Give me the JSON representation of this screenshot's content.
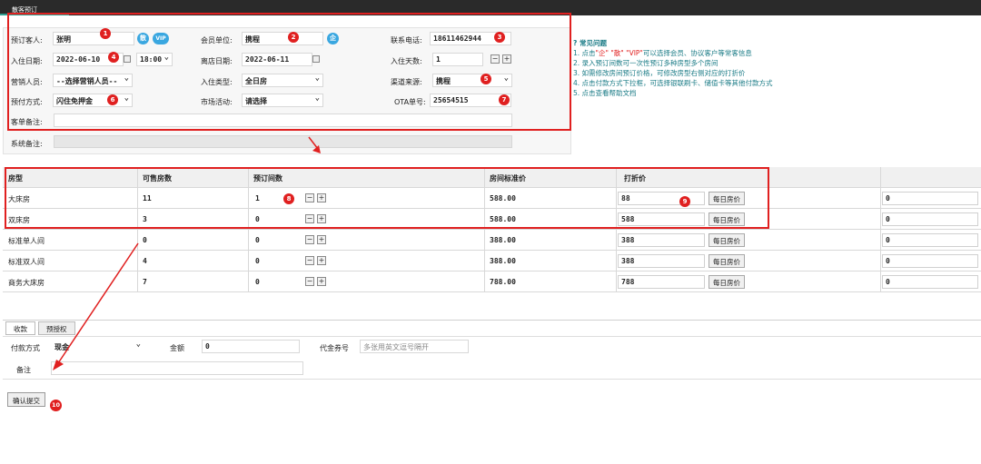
{
  "window": {
    "tab_title": "散客预订"
  },
  "form": {
    "guest_label": "预订客人:",
    "guest_value": "张明",
    "discount_icon": "散",
    "vip_icon": "VIP",
    "member_label": "会员单位:",
    "member_value": "携程",
    "member_icon": "企",
    "phone_label": "联系电话:",
    "phone_value": "18611462944",
    "checkin_label": "入住日期:",
    "checkin_value": "2022-06-10",
    "checkin_time": "18:00",
    "checkout_label": "离店日期:",
    "checkout_value": "2022-06-11",
    "days_label": "入住天数:",
    "days_value": "1",
    "sales_label": "营销人员:",
    "sales_value": "--选择营销人员--",
    "type_label": "入住类型:",
    "type_value": "全日房",
    "channel_label": "渠道来源:",
    "channel_value": "携程",
    "pay_label": "预付方式:",
    "pay_value": "闪住免押金",
    "market_label": "市场活动:",
    "market_value": "请选择",
    "ota_label": "OTA单号:",
    "ota_value": "25654515",
    "remark_label": "客单备注:",
    "remark_value": "",
    "sys_remark_label": "系统备注:"
  },
  "faq": {
    "title": "? 常见问题",
    "items": [
      [
        "1. 点击",
        "\"企\" \"散\" \"VIP\"",
        "可以选择会员、协议客户等常客信息"
      ],
      [
        "2. 录入预订间数可一次性预订多种房型多个房间",
        "",
        ""
      ],
      [
        "3. 如需修改房间预订价格，可修改房型右侧对应的打折价",
        "",
        ""
      ],
      [
        "4. 点击付款方式下拉框，可选择银联刷卡、储值卡等其他付款方式",
        "",
        ""
      ],
      [
        "5. 点击查看帮助文档",
        "",
        ""
      ]
    ]
  },
  "table": {
    "headers": [
      "房型",
      "可售房数",
      "预订间数",
      "房间标准价",
      "打折价",
      ""
    ],
    "daily_btn": "每日房价",
    "rows": [
      {
        "type": "大床房",
        "avail": "11",
        "qty": "1",
        "std": "588.00",
        "disc": "88",
        "extra": "0"
      },
      {
        "type": "双床房",
        "avail": "3",
        "qty": "0",
        "std": "588.00",
        "disc": "588",
        "extra": "0"
      },
      {
        "type": "标准单人间",
        "avail": "0",
        "qty": "0",
        "std": "388.00",
        "disc": "388",
        "extra": "0"
      },
      {
        "type": "标准双人间",
        "avail": "4",
        "qty": "0",
        "std": "388.00",
        "disc": "388",
        "extra": "0"
      },
      {
        "type": "商务大床房",
        "avail": "7",
        "qty": "0",
        "std": "788.00",
        "disc": "788",
        "extra": "0"
      }
    ]
  },
  "payment": {
    "tab_collect": "收款",
    "tab_preauth": "预授权",
    "method_label": "付款方式",
    "method_value": "现金",
    "amount_label": "金额",
    "amount_value": "0",
    "voucher_label": "代金券号",
    "voucher_placeholder": "多张用英文逗号隔开",
    "remark_label": "备注",
    "submit_label": "确认提交"
  },
  "badges": [
    "1",
    "2",
    "3",
    "4",
    "5",
    "6",
    "7",
    "8",
    "9",
    "10"
  ],
  "colors": {
    "accent": "#3aa7e0",
    "annotation": "#e02020",
    "faq_text": "#1a7b86",
    "tab_underline": "#2e9e8f"
  }
}
